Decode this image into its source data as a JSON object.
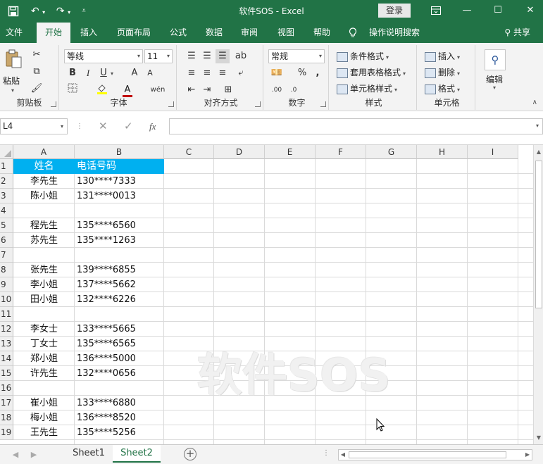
{
  "titlebar": {
    "title": "软件SOS  -  Excel",
    "login": "登录",
    "save_icon": "save-icon",
    "undo_icon": "undo-icon",
    "redo_icon": "redo-icon",
    "customize_icon": "customize-qat-icon"
  },
  "tabs": [
    {
      "label": "文件",
      "active": false
    },
    {
      "label": "开始",
      "active": true
    },
    {
      "label": "插入",
      "active": false
    },
    {
      "label": "页面布局",
      "active": false
    },
    {
      "label": "公式",
      "active": false
    },
    {
      "label": "数据",
      "active": false
    },
    {
      "label": "审阅",
      "active": false
    },
    {
      "label": "视图",
      "active": false
    },
    {
      "label": "帮助",
      "active": false
    }
  ],
  "tellme": "操作说明搜索",
  "share": "共享",
  "ribbon": {
    "clipboard": {
      "label": "剪贴板",
      "paste": "粘贴"
    },
    "font": {
      "label": "字体",
      "font_name": "等线",
      "font_size": "11",
      "bold": "B",
      "italic": "I",
      "underline": "U",
      "grow": "A",
      "shrink": "A",
      "font_color": "A",
      "phonetic": "wén"
    },
    "alignment": {
      "label": "对齐方式"
    },
    "number": {
      "label": "数字",
      "format": "常规",
      "percent": "%",
      "comma": ","
    },
    "styles": {
      "label": "样式",
      "conditional": "条件格式",
      "table": "套用表格格式",
      "cell_styles": "单元格样式"
    },
    "cells": {
      "label": "单元格",
      "insert": "插入",
      "delete": "删除",
      "format": "格式"
    },
    "editing": {
      "label": "编辑"
    }
  },
  "formula_bar": {
    "name_box": "L4",
    "cancel": "✕",
    "enter": "✓",
    "fx": "fx",
    "value": ""
  },
  "columns": [
    "A",
    "B",
    "C",
    "D",
    "E",
    "F",
    "G",
    "H",
    "I"
  ],
  "rows": [
    "1",
    "2",
    "3",
    "4",
    "5",
    "6",
    "7",
    "8",
    "9",
    "10",
    "11",
    "12",
    "13",
    "14",
    "15",
    "16",
    "17",
    "18",
    "19"
  ],
  "table": {
    "headers": [
      "姓名",
      "电话号码"
    ],
    "data": [
      [
        "李先生",
        "130****7333"
      ],
      [
        "陈小姐",
        "131****0013"
      ],
      [
        "",
        ""
      ],
      [
        "程先生",
        "135****6560"
      ],
      [
        "苏先生",
        "135****1263"
      ],
      [
        "",
        ""
      ],
      [
        "张先生",
        "139****6855"
      ],
      [
        "李小姐",
        "137****5662"
      ],
      [
        "田小姐",
        "132****6226"
      ],
      [
        "",
        ""
      ],
      [
        "李女士",
        "133****5665"
      ],
      [
        "丁女士",
        "135****6565"
      ],
      [
        "郑小姐",
        "136****5000"
      ],
      [
        "许先生",
        "132****0656"
      ],
      [
        "",
        ""
      ],
      [
        "崔小姐",
        "133****6880"
      ],
      [
        "梅小姐",
        "136****8520"
      ],
      [
        "王先生",
        "135****5256"
      ]
    ]
  },
  "watermark": "软件SOS",
  "sheets": [
    {
      "label": "Sheet1",
      "active": false
    },
    {
      "label": "Sheet2",
      "active": true
    }
  ],
  "colors": {
    "excel_green": "#217346",
    "header_fill": "#00b0f0",
    "header_text": "#ffffff"
  }
}
